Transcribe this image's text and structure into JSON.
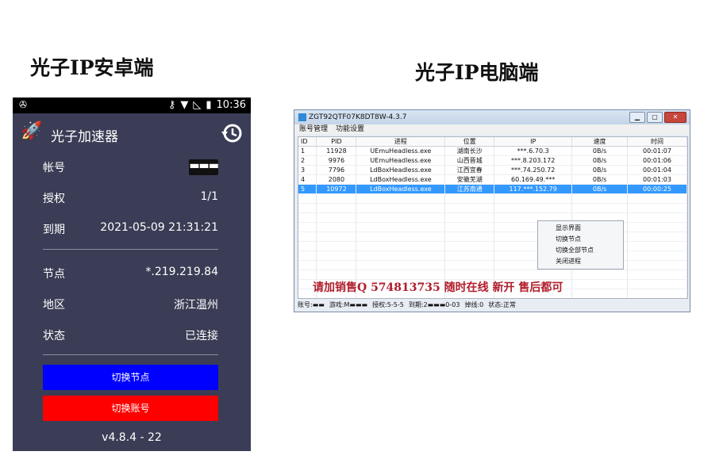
{
  "titles": {
    "android": "光子IP安卓端",
    "pc": "光子IP电脑端"
  },
  "phone": {
    "status": {
      "left_icon": "pinwheel-icon",
      "time": "10:36"
    },
    "app_title": "光子加速器",
    "rows": [
      {
        "label": "帐号",
        "value": "▬▬▬"
      },
      {
        "label": "授权",
        "value": "1/1"
      },
      {
        "label": "到期",
        "value": "2021-05-09 21:31:21"
      },
      {
        "label": "节点",
        "value": "*.219.219.84"
      },
      {
        "label": "地区",
        "value": "浙江温州"
      },
      {
        "label": "状态",
        "value": "已连接"
      }
    ],
    "btn_switch_node": "切换节点",
    "btn_switch_account": "切换账号",
    "version": "v4.8.4 - 22",
    "colors": {
      "bg": "#3a3d55",
      "btn_blue": "#0000ff",
      "btn_red": "#ff0000"
    }
  },
  "win": {
    "title": "ZGT92QTF07K8DT8W-4.3.7",
    "menu": [
      "账号管理",
      "功能设置"
    ],
    "columns": [
      "ID",
      "PID",
      "进程",
      "位置",
      "IP",
      "速度",
      "时间"
    ],
    "rows": [
      [
        "1",
        "11928",
        "UEmuHeadless.exe",
        "湖南长沙",
        "***.6.70.3",
        "0B/s",
        "00:01:07"
      ],
      [
        "2",
        "9976",
        "UEmuHeadless.exe",
        "山西晋城",
        "***.8.203.172",
        "0B/s",
        "00:01:06"
      ],
      [
        "3",
        "7796",
        "LdBoxHeadless.exe",
        "江西宜春",
        "***.74.250.72",
        "0B/s",
        "00:01:04"
      ],
      [
        "4",
        "2080",
        "LdBoxHeadless.exe",
        "安徽芜湖",
        "60.169.49.***",
        "0B/s",
        "00:01:03"
      ],
      [
        "5",
        "10972",
        "LdBoxHeadless.exe",
        "江苏南通",
        "117.***.152.79",
        "0B/s",
        "00:00:25"
      ]
    ],
    "context_menu": [
      "显示界面",
      "切换节点",
      "切换全部节点",
      "关闭进程"
    ],
    "promo": "请加销售Q 574813735 随时在线 新开 售后都可",
    "status": {
      "account": "账号:▬▬",
      "game": "游戏:M▬▬▬",
      "auth": "授权:5-5-5",
      "expire": "到期:2▬▬▬0-03",
      "queue": "掉线:0",
      "state": "状态:正常"
    },
    "selected_row_color": "#3399ff"
  }
}
